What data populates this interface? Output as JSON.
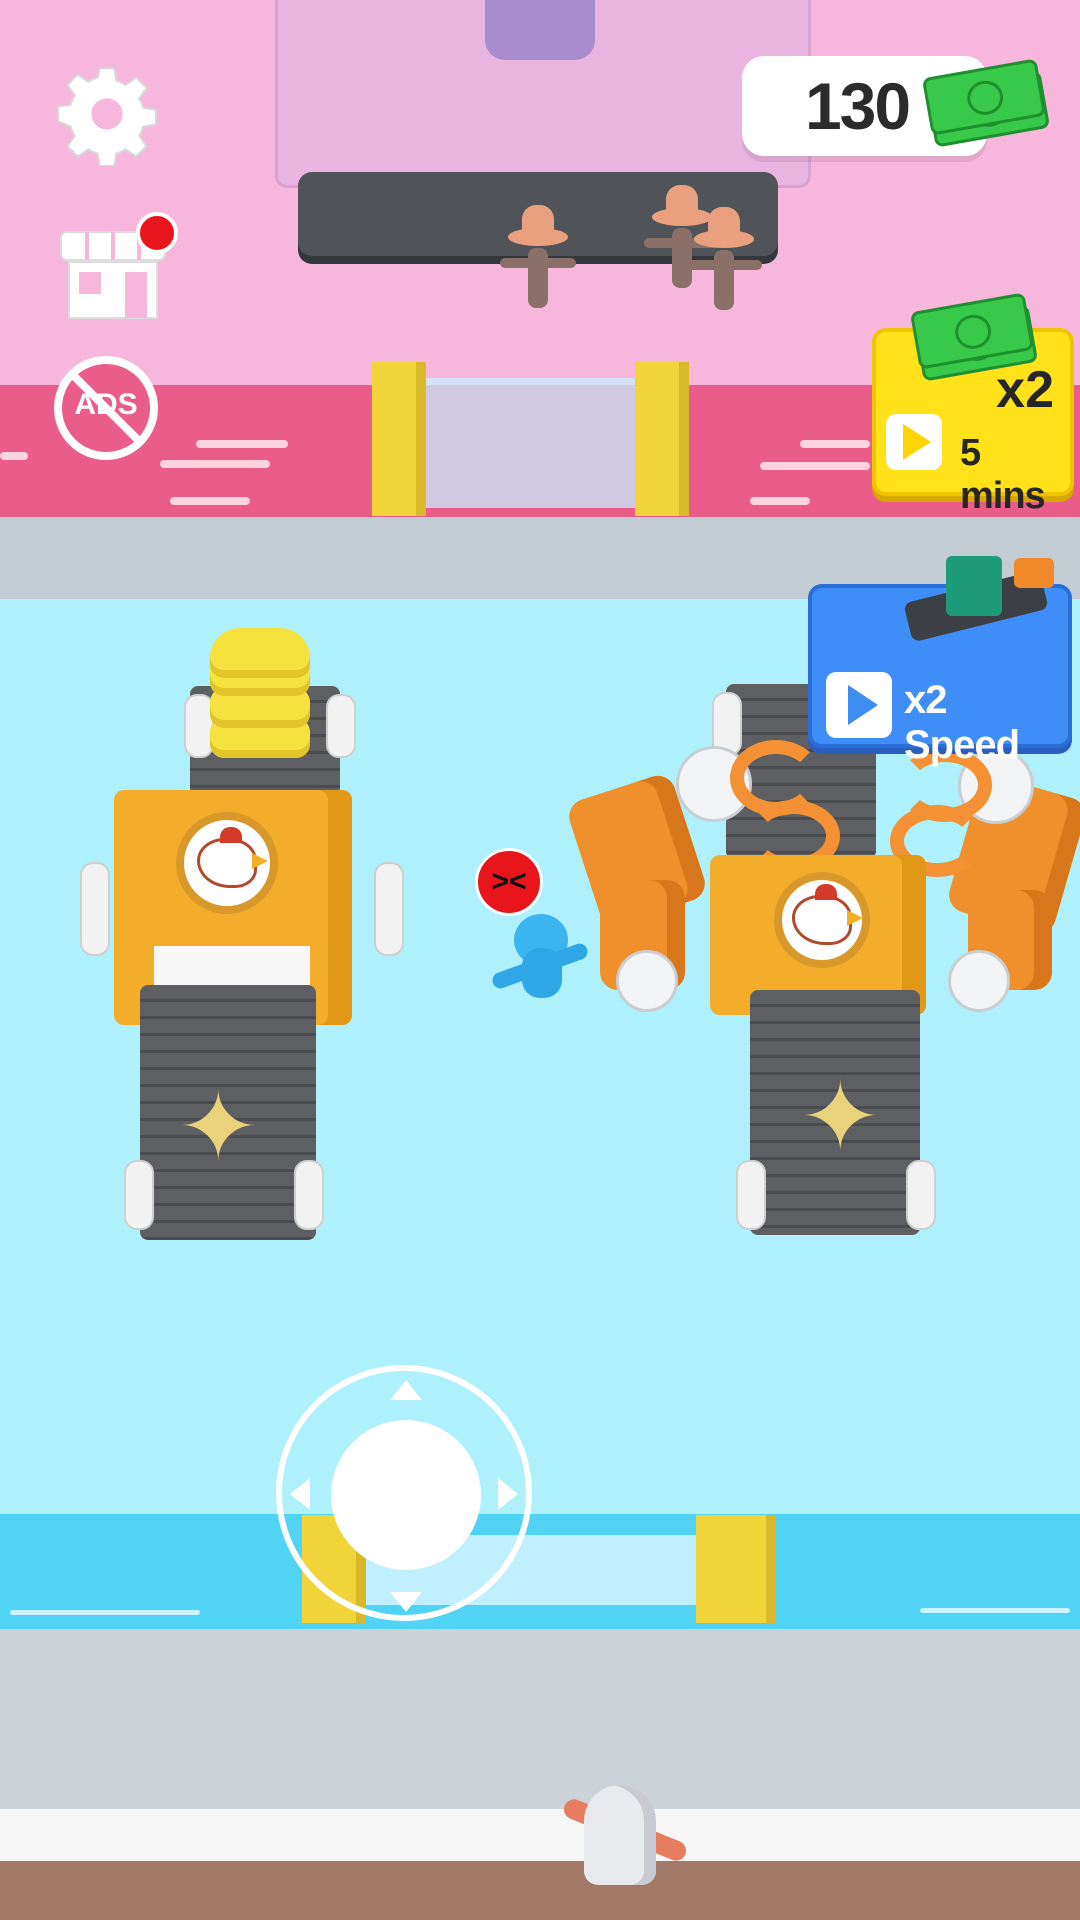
{
  "hud": {
    "money": "130",
    "cash_icon": "cash-stack-icon",
    "settings_icon": "gear-icon",
    "shop_icon": "shop-icon",
    "no_ads_icon": "no-ads-icon",
    "no_ads_label": "ADS"
  },
  "boost": {
    "multiplier": "x2",
    "duration": "5 mins",
    "icon": "play-icon"
  },
  "speed": {
    "label": "x2 Speed",
    "icon": "play-icon"
  },
  "joystick": {
    "icon": "joystick-icon"
  },
  "colors": {
    "pink_floor": "#f7b6dc",
    "blue_floor": "#aef0fb",
    "boost_yellow": "#ffe21a",
    "speed_blue": "#3f8df6",
    "notification_red": "#e8151d"
  }
}
